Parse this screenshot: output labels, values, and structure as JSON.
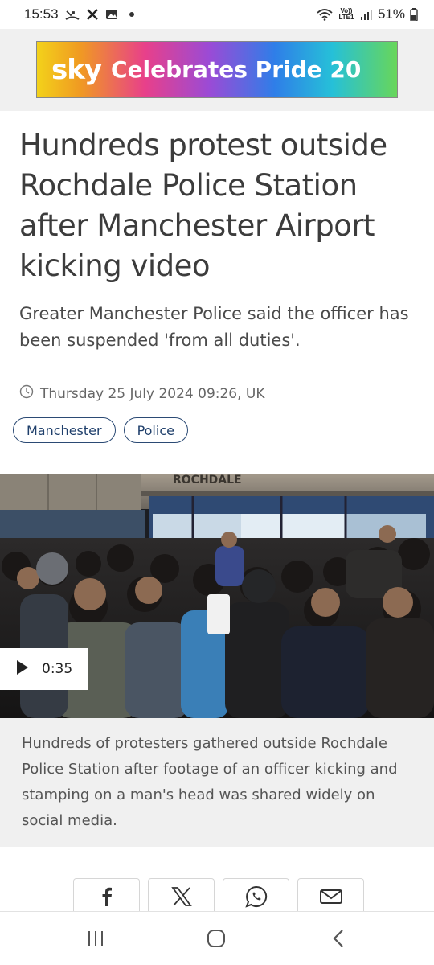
{
  "status_bar": {
    "time": "15:53",
    "battery": "51%",
    "network_label": "Vo)) LTE1",
    "icons": [
      "missed-call-icon",
      "x-app-icon",
      "gallery-icon",
      "notification-dot-icon",
      "wifi-icon",
      "signal-icon",
      "battery-icon"
    ]
  },
  "banner": {
    "logo": "sky",
    "text": "Celebrates Pride 20"
  },
  "article": {
    "headline": "Hundreds protest outside Rochdale Police Station after Manchester Airport kicking video",
    "standfirst": "Greater Manchester Police said the officer has been suspended 'from all duties'.",
    "timestamp": "Thursday 25 July 2024 09:26, UK",
    "tags": [
      "Manchester",
      "Police"
    ]
  },
  "video": {
    "duration": "0:35",
    "sign_text": "ROCHDALE",
    "caption": "Hundreds of protesters gathered outside Rochdale Police Station after footage of an officer kicking and stamping on a man's head was shared widely on social media."
  },
  "share": {
    "buttons": [
      "facebook-icon",
      "x-icon",
      "whatsapp-icon",
      "email-icon"
    ]
  },
  "nav": {
    "buttons": [
      "recent-apps-icon",
      "home-icon",
      "back-icon"
    ]
  },
  "colors": {
    "tag_border": "#2b4a74",
    "caption_bg": "#f0f0f0",
    "headline": "#3c3c3c"
  }
}
